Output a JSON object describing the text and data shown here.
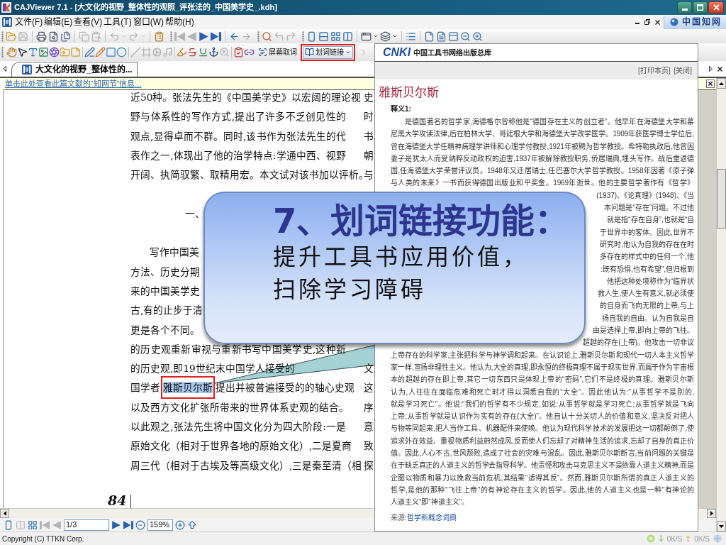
{
  "window": {
    "title": "CAJViewer 7.1 - [大文化的视野_整体性的观照_评张法的_中国美学史_.kdh]"
  },
  "menu": {
    "items": [
      "文件(F)",
      "编辑(E)",
      "查看(V)",
      "工具(T)",
      "窗口(W)",
      "帮助(H)"
    ],
    "brand": "中国知网"
  },
  "toolbar_1": [
    [
      [
        {
          "kind": "open",
          "disabled": false
        },
        {
          "kind": "save",
          "disabled": true
        }
      ],
      [
        {
          "kind": "print",
          "disabled": false
        },
        {
          "kind": "preview",
          "disabled": false
        },
        {
          "kind": "pages",
          "disabled": false
        }
      ],
      [
        {
          "kind": "copy",
          "disabled": true
        },
        {
          "kind": "paste",
          "disabled": true
        }
      ],
      [
        {
          "kind": "undo",
          "disabled": true
        },
        {
          "kind": "caret",
          "disabled": true
        },
        {
          "kind": "redo",
          "disabled": true
        },
        {
          "kind": "caret",
          "disabled": true
        }
      ],
      [
        {
          "kind": "properties",
          "disabled": false
        }
      ]
    ],
    [
      [
        {
          "kind": "first",
          "disabled": true
        },
        {
          "kind": "prev",
          "disabled": true
        },
        {
          "kind": "next",
          "disabled": false
        },
        {
          "kind": "last",
          "disabled": false
        }
      ],
      [
        {
          "kind": "back",
          "disabled": false
        },
        {
          "kind": "forward",
          "disabled": true
        }
      ]
    ],
    [
      [
        {
          "kind": "search",
          "disabled": false
        },
        {
          "kind": "undo_arrow",
          "disabled": true
        },
        {
          "kind": "redo_arrow",
          "disabled": true
        }
      ]
    ],
    [
      [
        {
          "kind": "single",
          "disabled": false
        },
        {
          "kind": "rows",
          "disabled": false
        },
        {
          "kind": "grid",
          "disabled": false
        },
        {
          "kind": "columns",
          "disabled": false
        }
      ],
      [
        {
          "kind": "window",
          "disabled": false
        },
        {
          "kind": "caret",
          "disabled": false
        },
        {
          "kind": "windows",
          "disabled": false
        },
        {
          "kind": "caret",
          "disabled": false
        }
      ],
      [
        {
          "kind": "list",
          "disabled": false
        }
      ],
      [
        {
          "kind": "page",
          "disabled": false
        },
        {
          "kind": "page_text",
          "disabled": false
        },
        {
          "kind": "page_panel",
          "disabled": false
        },
        {
          "kind": "zoom_out",
          "disabled": false
        },
        {
          "kind": "zoom_in",
          "disabled": false
        }
      ]
    ]
  ],
  "toolbar_2": {
    "groups": [
      [
        {
          "kind": "hand",
          "disabled": false
        },
        {
          "kind": "pointer",
          "disabled": false
        },
        {
          "kind": "text",
          "disabled": false
        },
        {
          "kind": "image",
          "disabled": false
        },
        {
          "kind": "aperture",
          "disabled": false
        },
        {
          "kind": "folder_arrow",
          "disabled": false
        },
        {
          "kind": "note",
          "disabled": false
        }
      ],
      [
        {
          "kind": "pen",
          "disabled": false
        },
        {
          "kind": "pencil",
          "disabled": false
        },
        {
          "kind": "rect",
          "disabled": false
        },
        {
          "kind": "circle",
          "disabled": false
        }
      ],
      [
        {
          "kind": "slash",
          "disabled": true
        },
        {
          "kind": "frame",
          "disabled": true
        },
        {
          "kind": "gear",
          "disabled": true
        },
        {
          "kind": "music",
          "disabled": true
        }
      ],
      [
        {
          "kind": "highlighter",
          "disabled": false
        },
        {
          "kind": "strike",
          "disabled": false
        },
        {
          "kind": "underline",
          "disabled": false
        },
        {
          "kind": "anchor",
          "disabled": false
        },
        {
          "kind": "search_x",
          "disabled": true
        }
      ],
      [
        {
          "kind": "check_doc",
          "disabled": false
        },
        {
          "kind": "link",
          "disabled": false
        }
      ]
    ],
    "text_buttons": [
      {
        "kind": "screen",
        "label": "屏幕取词",
        "framed": false,
        "dropdown": false
      },
      {
        "kind": "book",
        "label": "划词链接",
        "framed": true,
        "dropdown": true
      }
    ],
    "trailing": [
      {
        "kind": "more",
        "disabled": true
      }
    ]
  },
  "tabs": [
    {
      "label": "大文化的视野_整体性的...",
      "selected": true
    }
  ],
  "info_bar": {
    "link": "单击此处查看此篇文献的“知网节”信息..."
  },
  "document": {
    "lines": [
      {
        "kind": "full",
        "text": "近50种。张法先生的《中国美学史》以宏阔的理论视",
        "side": "史"
      },
      {
        "kind": "full",
        "text": "野与体系性的写作方式,提出了许多不乏创见性的",
        "side": "时"
      },
      {
        "kind": "full",
        "text": "观点,显得卓而不群。同时,该书作为张法先生的代",
        "side": "书"
      },
      {
        "kind": "full",
        "text": "表作之一,体现出了他的治学特点:学通中西、视野",
        "side": "朝"
      },
      {
        "kind": "full",
        "text": "开阔、执简驭繁、取精用宏。本文试对该书加以评析。",
        "side": "与"
      },
      {
        "kind": "heading",
        "text": "一、"
      },
      {
        "kind": "indent",
        "text": "写作中国美"
      },
      {
        "kind": "cut",
        "text": "方法、历史分期"
      },
      {
        "kind": "cut",
        "text": "来的中国美学史"
      },
      {
        "kind": "cut",
        "text": "古,有的止步于清"
      },
      {
        "kind": "cut",
        "text": "更是各个不同。"
      },
      {
        "kind": "full",
        "text": "的历史观重新审视与重新书写中国美学史,这种新"
      },
      {
        "kind": "cut",
        "text": "的历史观,即19世纪末中国学人接受的",
        "side": "文"
      },
      {
        "kind": "segments",
        "segments": [
          {
            "text": "国学者",
            "selected": false,
            "framed": false
          },
          {
            "text": "雅斯贝尔斯",
            "selected": true,
            "framed": true
          },
          {
            "text": "提出并被普遍接受的的轴心史观",
            "selected": false,
            "framed": false
          }
        ],
        "side": "这"
      },
      {
        "kind": "full",
        "text": "以及西方文化扩张所带来的世界体系史观的结合。",
        "side": "序"
      },
      {
        "kind": "full",
        "text": "以此观之,张法先生将中国文化分为四大阶段:一是",
        "side": "意"
      },
      {
        "kind": "full",
        "text": "原始文化（相对于世界各地的原始文化）,二是夏商",
        "side": "致"
      },
      {
        "kind": "full",
        "text": "周三代（相对于古埃及等高级文化）,三是秦至清（相",
        "side": "探"
      }
    ],
    "page_number": "84"
  },
  "popup": {
    "logo": "CNKI",
    "site_name": "中国工具书网络出版总库",
    "actions": [
      "[打印本页]",
      "[关闭]"
    ],
    "entry_title": "雅斯贝尔斯",
    "sense_label": "释义1:",
    "lines": [
      {
        "kind": "first",
        "text": "是德国著名的哲学家,海德格尔曾称他是“德国存在主义的创立者”。他早年在海德堡大学和慕"
      },
      {
        "kind": "full",
        "text": "尼黑大学攻读法律,后在柏林大学、哥廷根大学和海德堡大学改学医学。1909年获医学博士学位后,"
      },
      {
        "kind": "full",
        "text": "曾在海德堡大学任精神病理学讲师和心理学付教授,1921年被聘为哲学教授。希特勒执政后,他曾因"
      },
      {
        "kind": "full",
        "text": "妻子是犹太人而受纳粹反动政权的迫害,1937年被解除教授职务,侨居瑞典,埋头写作。战后重返德"
      },
      {
        "kind": "full",
        "text": "国,任海德堡大学荣誉评议员。1948年又迁居瑞士,任巴塞尔大学哲学教授。1958年因著《原子弹"
      },
      {
        "kind": "full",
        "text": "与人类的未来》一书而获得德国出版业和平奖金。1969年逝世。他的主要哲学著作有《哲学》"
      },
      {
        "kind": "partial",
        "text": "(1937)、《论真理》(1948)、《当"
      },
      {
        "kind": "partial",
        "text": "本问题是“存在”问题。不过他"
      },
      {
        "kind": "partial",
        "text": "就是指“存在自身”,也就是“自"
      },
      {
        "kind": "partial",
        "text": "于世界中的客体。因此,世界不"
      },
      {
        "kind": "partial",
        "text": "研究时,他认为自我的存在在时"
      },
      {
        "kind": "partial",
        "text": "多存在的样式中的任何一个,他"
      },
      {
        "kind": "partial",
        "text": ":既有恐惧,也有希望”,但归根到"
      },
      {
        "kind": "partial",
        "text": "他把这种处境称作为“临界状"
      },
      {
        "kind": "partial",
        "text": "救人生,使人生有意义,就必须使"
      },
      {
        "kind": "partial",
        "text": "的自身而飞向无限的上帝,与上"
      },
      {
        "kind": "partial",
        "text": "扬自我的自由。认为自我是自"
      },
      {
        "kind": "partial",
        "text": "由是选择上帝,即向上帝的飞往。"
      },
      {
        "kind": "partial",
        "text": "超越的存在(上帝)。他攻击一切非议"
      },
      {
        "kind": "full",
        "text": "上帝存在的科学家,主张把科学与神学调和起来。在认识论上,雅斯贝尔斯和现代一切人本主义哲学"
      },
      {
        "kind": "full",
        "text": "家一样,宣扬非理性主义。他认为,大全的真理,即永恒的终极真理不属于现实世界,而属于作为宇宙根"
      },
      {
        "kind": "full",
        "text": "本的超越的存在即上帝,其它一切东西只是体现上帝的“密码”,它们不是终极的真理。雅斯贝尔斯"
      },
      {
        "kind": "full",
        "text": "认为,人往往在面临危难和死亡时才得以洞悉自我的“大全”。因此他认为:“从事哲学不是别的,"
      },
      {
        "kind": "full",
        "text": "就是学习死亡”。他说:“我们的哲学有不少规定,如说:从事哲学就是学习死亡;从事哲学就是飞向"
      },
      {
        "kind": "full",
        "text": "上帝;从事哲学就是认识作为实有的存在(大全)”。他自认十分关切人的价值和意义,坚决反对把人"
      },
      {
        "kind": "full",
        "text": "与物等同起来,把人当作工具、机器配件来使唤。他认为现代科学技术的发展把这一切都颠倒了,使"
      },
      {
        "kind": "full",
        "text": "追求外在效益、重视物质利益蔚然成风,反而使人们忘却了对精神生活的追求,忘却了自身的真正价"
      },
      {
        "kind": "full",
        "text": "值。因此,人心不古,世风颓败,造成了社会的灾难与混乱。因此,雅斯贝尔斯断言,当前问题的关键是"
      },
      {
        "kind": "full",
        "text": "在于缺乏真正的人道主义的哲学去指导科学。他责怪和攻击马克思主义不是依靠人道主义精神,而是"
      },
      {
        "kind": "full",
        "text": "企图以物质和暴力以挽救当前危机,其结果“适得其反”。然而,雅斯贝尔斯所谓的真正人道主义的"
      },
      {
        "kind": "full",
        "text": "哲学,是他的那种“飞往上帝”的有神论存在主义的哲学。因此,他的人道主义也是一种“有神论的"
      },
      {
        "kind": "last",
        "text": "人道主义”即“神道主义”。"
      }
    ],
    "source_label": "来源:",
    "source_link": "哲学新概念词典"
  },
  "callout": {
    "title": "7、划词链接功能：",
    "lines": [
      "提升工具书应用价值，",
      "扫除学习障碍"
    ]
  },
  "status_toolbar": {
    "items": [
      {
        "kind": "single",
        "disabled": false
      },
      {
        "kind": "facing",
        "disabled": true
      },
      {
        "kind": "double",
        "disabled": false
      },
      {
        "kind": "first",
        "disabled": true
      },
      {
        "kind": "prev",
        "disabled": true
      },
      {
        "kind": "page_field",
        "value": "1/3"
      },
      {
        "kind": "next",
        "disabled": false
      },
      {
        "kind": "last",
        "disabled": false
      },
      {
        "kind": "circle_minus",
        "disabled": false
      },
      {
        "kind": "zoom_field",
        "value": "159%"
      },
      {
        "kind": "circle_plus",
        "disabled": false
      },
      {
        "kind": "up",
        "disabled": false
      }
    ]
  },
  "status_bar": {
    "copyright": "Copyright (C) TTKN Corp.",
    "speeds": [
      "0K/S",
      "0K/S"
    ]
  }
}
